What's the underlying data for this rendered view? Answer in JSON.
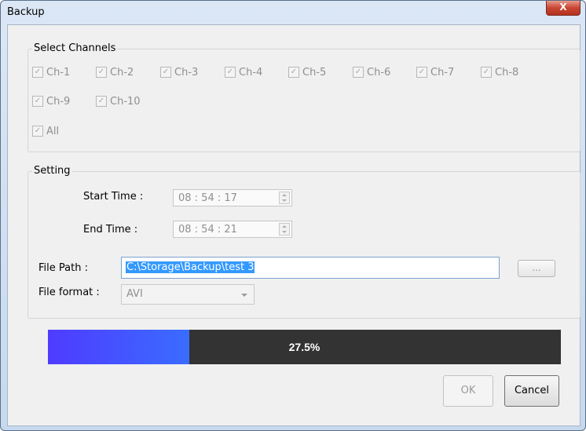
{
  "window": {
    "title": "Backup",
    "close_glyph": "X"
  },
  "channels": {
    "legend": "Select Channels",
    "items": [
      {
        "label": "Ch-1",
        "checked": true
      },
      {
        "label": "Ch-2",
        "checked": true
      },
      {
        "label": "Ch-3",
        "checked": true
      },
      {
        "label": "Ch-4",
        "checked": true
      },
      {
        "label": "Ch-5",
        "checked": true
      },
      {
        "label": "Ch-6",
        "checked": true
      },
      {
        "label": "Ch-7",
        "checked": true
      },
      {
        "label": "Ch-8",
        "checked": true
      },
      {
        "label": "Ch-9",
        "checked": true
      },
      {
        "label": "Ch-10",
        "checked": true
      }
    ],
    "all": {
      "label": "All",
      "checked": true
    }
  },
  "setting": {
    "legend": "Setting",
    "start_label": "Start Time :",
    "start_value": "08 : 54 : 17",
    "end_label": "End Time :",
    "end_value": "08 : 54 : 21",
    "path_label": "File Path :",
    "path_value": "C:\\Storage\\Backup\\test 3",
    "browse_label": "...",
    "format_label": "File format :",
    "format_value": "AVI"
  },
  "progress": {
    "percent_text": "27.5%",
    "fraction": 0.275
  },
  "buttons": {
    "ok": "OK",
    "cancel": "Cancel"
  },
  "colors": {
    "progress_fill": "#3f4dff",
    "progress_track": "#333333",
    "selection": "#3399ff"
  }
}
